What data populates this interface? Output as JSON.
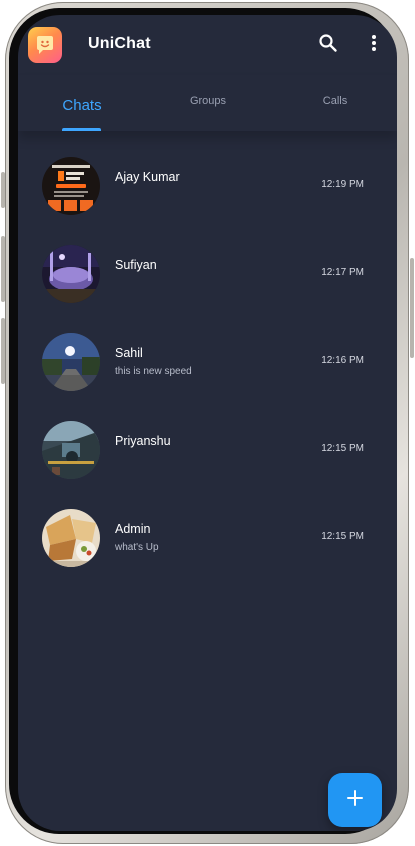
{
  "app": {
    "title": "UniChat",
    "logo_icon": "chat-bubble-smile-icon"
  },
  "toolbar": {
    "search_icon": "search-icon",
    "more_icon": "more-vertical-icon"
  },
  "tabs": [
    {
      "label": "Chats",
      "active": true
    },
    {
      "label": "Groups",
      "active": false
    },
    {
      "label": "Calls",
      "active": false
    }
  ],
  "chats": [
    {
      "name": "Ajay Kumar",
      "message": "",
      "time": "12:19 PM"
    },
    {
      "name": "Sufiyan",
      "message": "",
      "time": "12:17 PM"
    },
    {
      "name": "Sahil",
      "message": "this is new speed",
      "time": "12:16 PM"
    },
    {
      "name": "Priyanshu",
      "message": "",
      "time": "12:15 PM"
    },
    {
      "name": "Admin",
      "message": "what's Up",
      "time": "12:15 PM"
    }
  ],
  "fab": {
    "icon": "plus-icon"
  },
  "colors": {
    "background": "#252a3b",
    "accent": "#3ea6ff",
    "fab": "#2196f3"
  }
}
